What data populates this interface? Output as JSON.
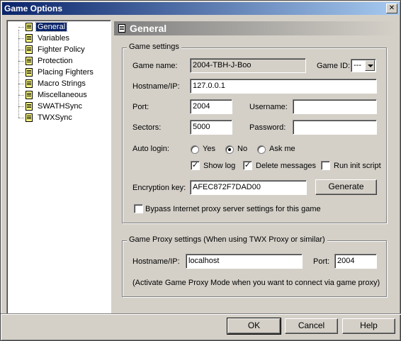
{
  "window": {
    "title": "Game Options",
    "close_glyph": "✕"
  },
  "tree": {
    "items": [
      {
        "label": "General",
        "selected": true,
        "icon": "doc-icon"
      },
      {
        "label": "Variables",
        "selected": false,
        "icon": "doc-icon"
      },
      {
        "label": "Fighter Policy",
        "selected": false,
        "icon": "doc-icon"
      },
      {
        "label": "Protection",
        "selected": false,
        "icon": "doc-icon"
      },
      {
        "label": "Placing Fighters",
        "selected": false,
        "icon": "doc-icon"
      },
      {
        "label": "Macro Strings",
        "selected": false,
        "icon": "doc-icon"
      },
      {
        "label": "Miscellaneous",
        "selected": false,
        "icon": "doc-icon"
      },
      {
        "label": "SWATHSync",
        "selected": false,
        "icon": "doc-icon"
      },
      {
        "label": "TWXSync",
        "selected": false,
        "icon": "doc-icon"
      }
    ]
  },
  "header": {
    "title": "General"
  },
  "game_settings": {
    "group_title": "Game settings",
    "game_name_label": "Game name:",
    "game_name_value": "2004-TBH-J-Boo",
    "game_id_label": "Game ID:",
    "game_id_value": "---",
    "hostname_label": "Hostname/IP:",
    "hostname_value": "127.0.0.1",
    "port_label": "Port:",
    "port_value": "2004",
    "username_label": "Username:",
    "username_value": "",
    "sectors_label": "Sectors:",
    "sectors_value": "5000",
    "password_label": "Password:",
    "password_value": "",
    "autologin_label": "Auto login:",
    "autologin_options": [
      "Yes",
      "No",
      "Ask me"
    ],
    "autologin_selected": "No",
    "show_log_label": "Show log",
    "show_log_checked": true,
    "delete_messages_label": "Delete messages",
    "delete_messages_checked": true,
    "run_init_label": "Run init script",
    "run_init_checked": false,
    "encryption_label": "Encryption key:",
    "encryption_value": "AFEC872F7DAD00",
    "generate_label": "Generate",
    "bypass_label": "Bypass Internet proxy server settings for this game",
    "bypass_checked": false
  },
  "proxy_settings": {
    "group_title": "Game Proxy settings (When using TWX Proxy or similar)",
    "hostname_label": "Hostname/IP:",
    "hostname_value": "localhost",
    "port_label": "Port:",
    "port_value": "2004",
    "note": "(Activate Game Proxy Mode when you want to connect via game proxy)"
  },
  "footer": {
    "ok_label": "OK",
    "cancel_label": "Cancel",
    "help_label": "Help"
  }
}
